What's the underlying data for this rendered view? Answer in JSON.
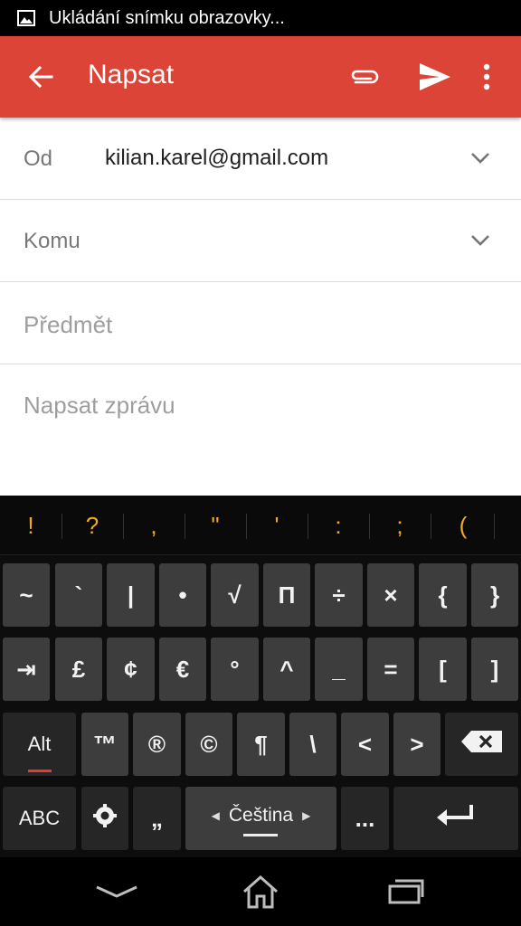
{
  "status_bar": {
    "notification_icon": "image-icon",
    "text": "Ukládání snímku obrazovky..."
  },
  "app_bar": {
    "color": "#db4437",
    "title": "Napsat",
    "icons": [
      "back-arrow-icon",
      "paperclip-icon",
      "send-icon",
      "more-vert-icon"
    ]
  },
  "compose": {
    "from_label": "Od",
    "from_value": "kilian.karel@gmail.com",
    "to_label": "Komu",
    "subject_placeholder": "Předmět",
    "body_placeholder": "Napsat zprávu"
  },
  "keyboard": {
    "suggestions": [
      "!",
      "?",
      ",",
      "\"",
      "'",
      ":",
      ";",
      "("
    ],
    "row1": [
      "~",
      "`",
      "|",
      "•",
      "√",
      "Π",
      "÷",
      "×",
      "{",
      "}"
    ],
    "row2": [
      "⇥",
      "£",
      "¢",
      "€",
      "°",
      "^",
      "_",
      "=",
      "[",
      "]"
    ],
    "row3": {
      "alt": "Alt",
      "keys": [
        "™",
        "®",
        "©",
        "¶",
        "\\",
        "<",
        ">"
      ]
    },
    "row4": {
      "abc": "ABC",
      "comma": "„",
      "language": "Čeština",
      "ellipsis": "..."
    }
  },
  "nav_bar": {
    "icons": [
      "back-chevron-icon",
      "home-icon",
      "recents-icon"
    ]
  }
}
